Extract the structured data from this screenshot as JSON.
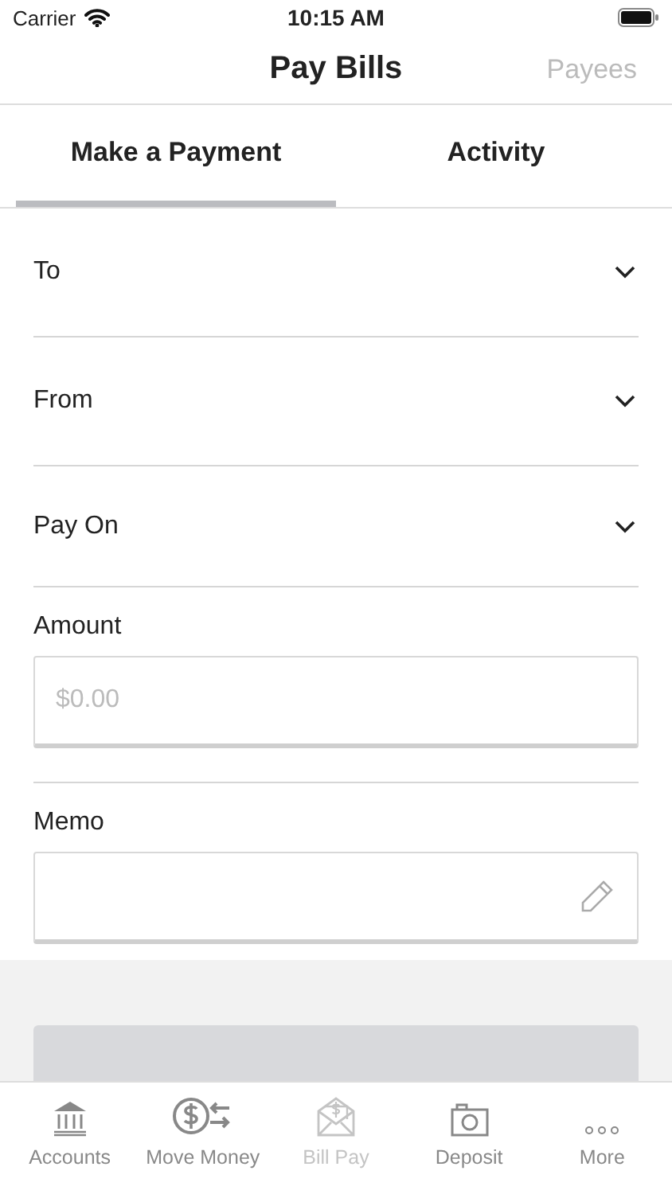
{
  "status_bar": {
    "carrier": "Carrier",
    "time": "10:15 AM"
  },
  "nav": {
    "title": "Pay Bills",
    "action": "Payees"
  },
  "tabs": [
    {
      "label": "Make a Payment",
      "selected": true
    },
    {
      "label": "Activity",
      "selected": false
    }
  ],
  "form": [
    {
      "kind": "select",
      "label": "To"
    },
    {
      "kind": "select",
      "label": "From"
    },
    {
      "kind": "select",
      "label": "Pay On"
    },
    {
      "kind": "input",
      "label": "Amount",
      "placeholder": "$0.00"
    },
    {
      "kind": "memo",
      "label": "Memo"
    }
  ],
  "tab_bar": [
    {
      "label": "Accounts",
      "selected": false
    },
    {
      "label": "Move Money",
      "selected": false
    },
    {
      "label": "Bill Pay",
      "selected": true
    },
    {
      "label": "Deposit",
      "selected": false
    },
    {
      "label": "More",
      "selected": false
    }
  ]
}
